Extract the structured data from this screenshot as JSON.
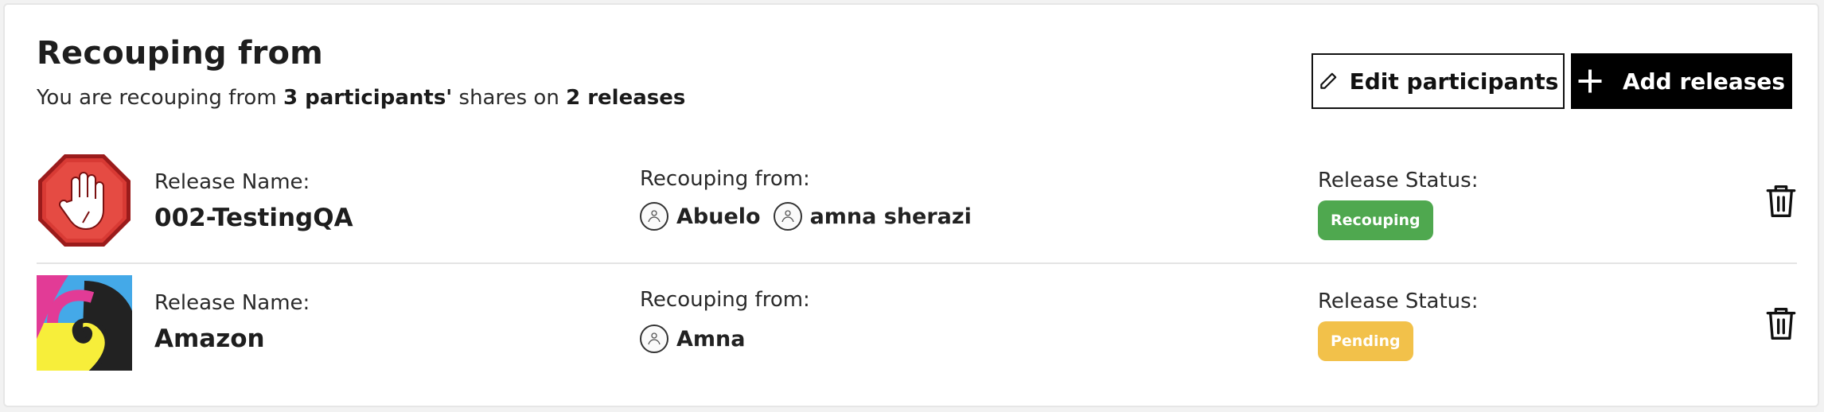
{
  "header": {
    "title": "Recouping from",
    "subtitle_prefix": "You are recouping from ",
    "subtitle_bold1": "3 participants'",
    "subtitle_mid": " shares on ",
    "subtitle_bold2": "2 releases"
  },
  "actions": {
    "edit_label": "Edit participants",
    "add_label": "Add releases",
    "edit_icon": "pencil-icon",
    "add_icon": "plus-icon"
  },
  "releases": [
    {
      "release_label": "Release Name:",
      "release_name": "002-TestingQA",
      "artwork": "stop-hand-icon",
      "from_label": "Recouping from:",
      "participants": [
        "Abuelo",
        "amna sherazi"
      ],
      "status_label": "Release Status:",
      "status": "Recouping",
      "status_color": "#4fa84f"
    },
    {
      "release_label": "Release Name:",
      "release_name": "Amazon",
      "artwork": "swirl-artwork",
      "from_label": "Recouping from:",
      "participants": [
        "Amna"
      ],
      "status_label": "Release Status:",
      "status": "Pending",
      "status_color": "#f2c14a"
    }
  ]
}
